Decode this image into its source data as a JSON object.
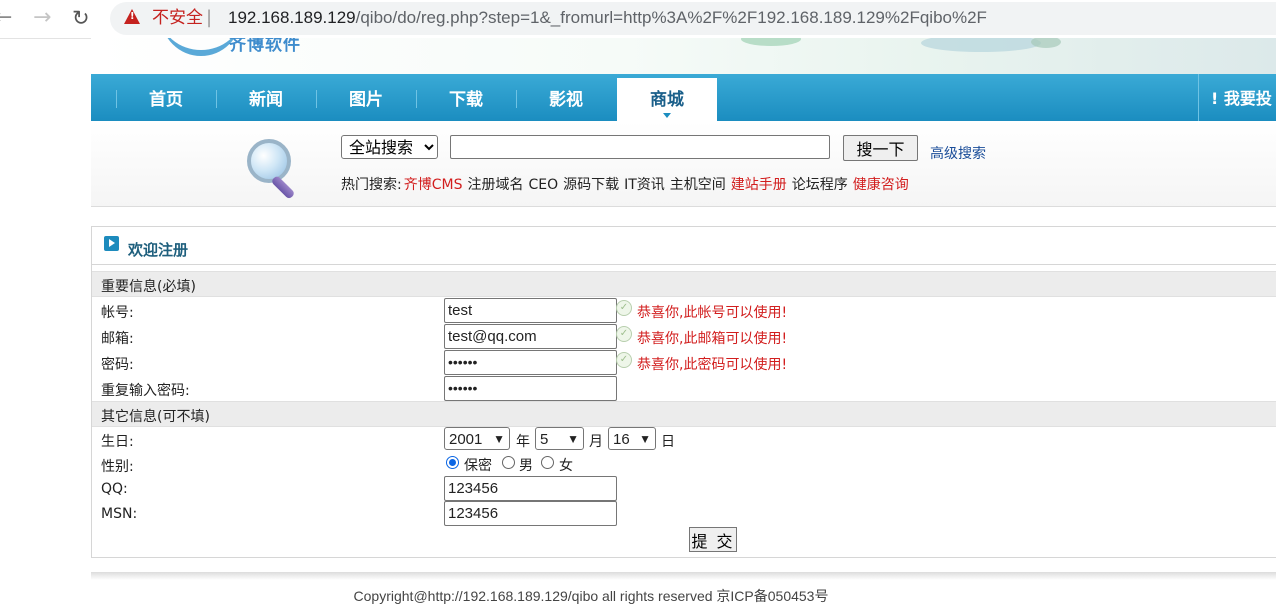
{
  "browser": {
    "security_label": "不安全",
    "separator": "|",
    "url_host": "192.168.189.129",
    "url_path": "/qibo/do/reg.php?step=1&_fromurl=http%3A%2F%2F192.168.189.129%2Fqibo%2F",
    "back_icon": "arrow-left-icon",
    "forward_icon": "arrow-right-icon",
    "reload_icon": "reload-icon",
    "warning_icon": "warning-triangle-icon"
  },
  "banner": {
    "logo_text": "齐博软件"
  },
  "nav": {
    "items": [
      {
        "label": "首页"
      },
      {
        "label": "新闻"
      },
      {
        "label": "图片"
      },
      {
        "label": "下载"
      },
      {
        "label": "影视"
      },
      {
        "label": "商城"
      }
    ],
    "active": "商城",
    "right_label": "! 我要投"
  },
  "search": {
    "scope_selected": "全站搜索",
    "query": "",
    "button": "搜一下",
    "advanced": "高级搜索",
    "hot_label": "热门搜索:",
    "hot_items": [
      {
        "label": "齐博CMS",
        "color": "#d21e1e"
      },
      {
        "label": "注册域名"
      },
      {
        "label": "CEO"
      },
      {
        "label": "源码下载"
      },
      {
        "label": "IT资讯"
      },
      {
        "label": "主机空间"
      },
      {
        "label": "建站手册",
        "color": "#d21e1e"
      },
      {
        "label": "论坛程序"
      },
      {
        "label": "健康咨询",
        "color": "#d21e1e"
      }
    ]
  },
  "register": {
    "title": "欢迎注册",
    "required_section": "重要信息(必填)",
    "optional_section": "其它信息(可不填)",
    "account_label": "帐号:",
    "account_value": "test",
    "account_ok": "恭喜你,此帐号可以使用!",
    "email_label": "邮箱:",
    "email_value": "test@qq.com",
    "email_ok": "恭喜你,此邮箱可以使用!",
    "password_label": "密码:",
    "password_mask": "••••••",
    "password_ok": "恭喜你,此密码可以使用!",
    "repeat_label": "重复输入密码:",
    "repeat_mask": "••••••",
    "birthday_label": "生日:",
    "year_value": "2001",
    "year_unit": "年",
    "month_value": "5",
    "month_unit": "月",
    "day_value": "16",
    "day_unit": "日",
    "gender_label": "性别:",
    "gender_options": [
      "保密",
      "男",
      "女"
    ],
    "gender_selected": "保密",
    "qq_label": "QQ:",
    "qq_value": "123456",
    "msn_label": "MSN:",
    "msn_value": "123456",
    "submit": "提 交"
  },
  "footer": {
    "copyright": "Copyright@http://192.168.189.129/qibo all rights reserved 京ICP备050453号"
  }
}
